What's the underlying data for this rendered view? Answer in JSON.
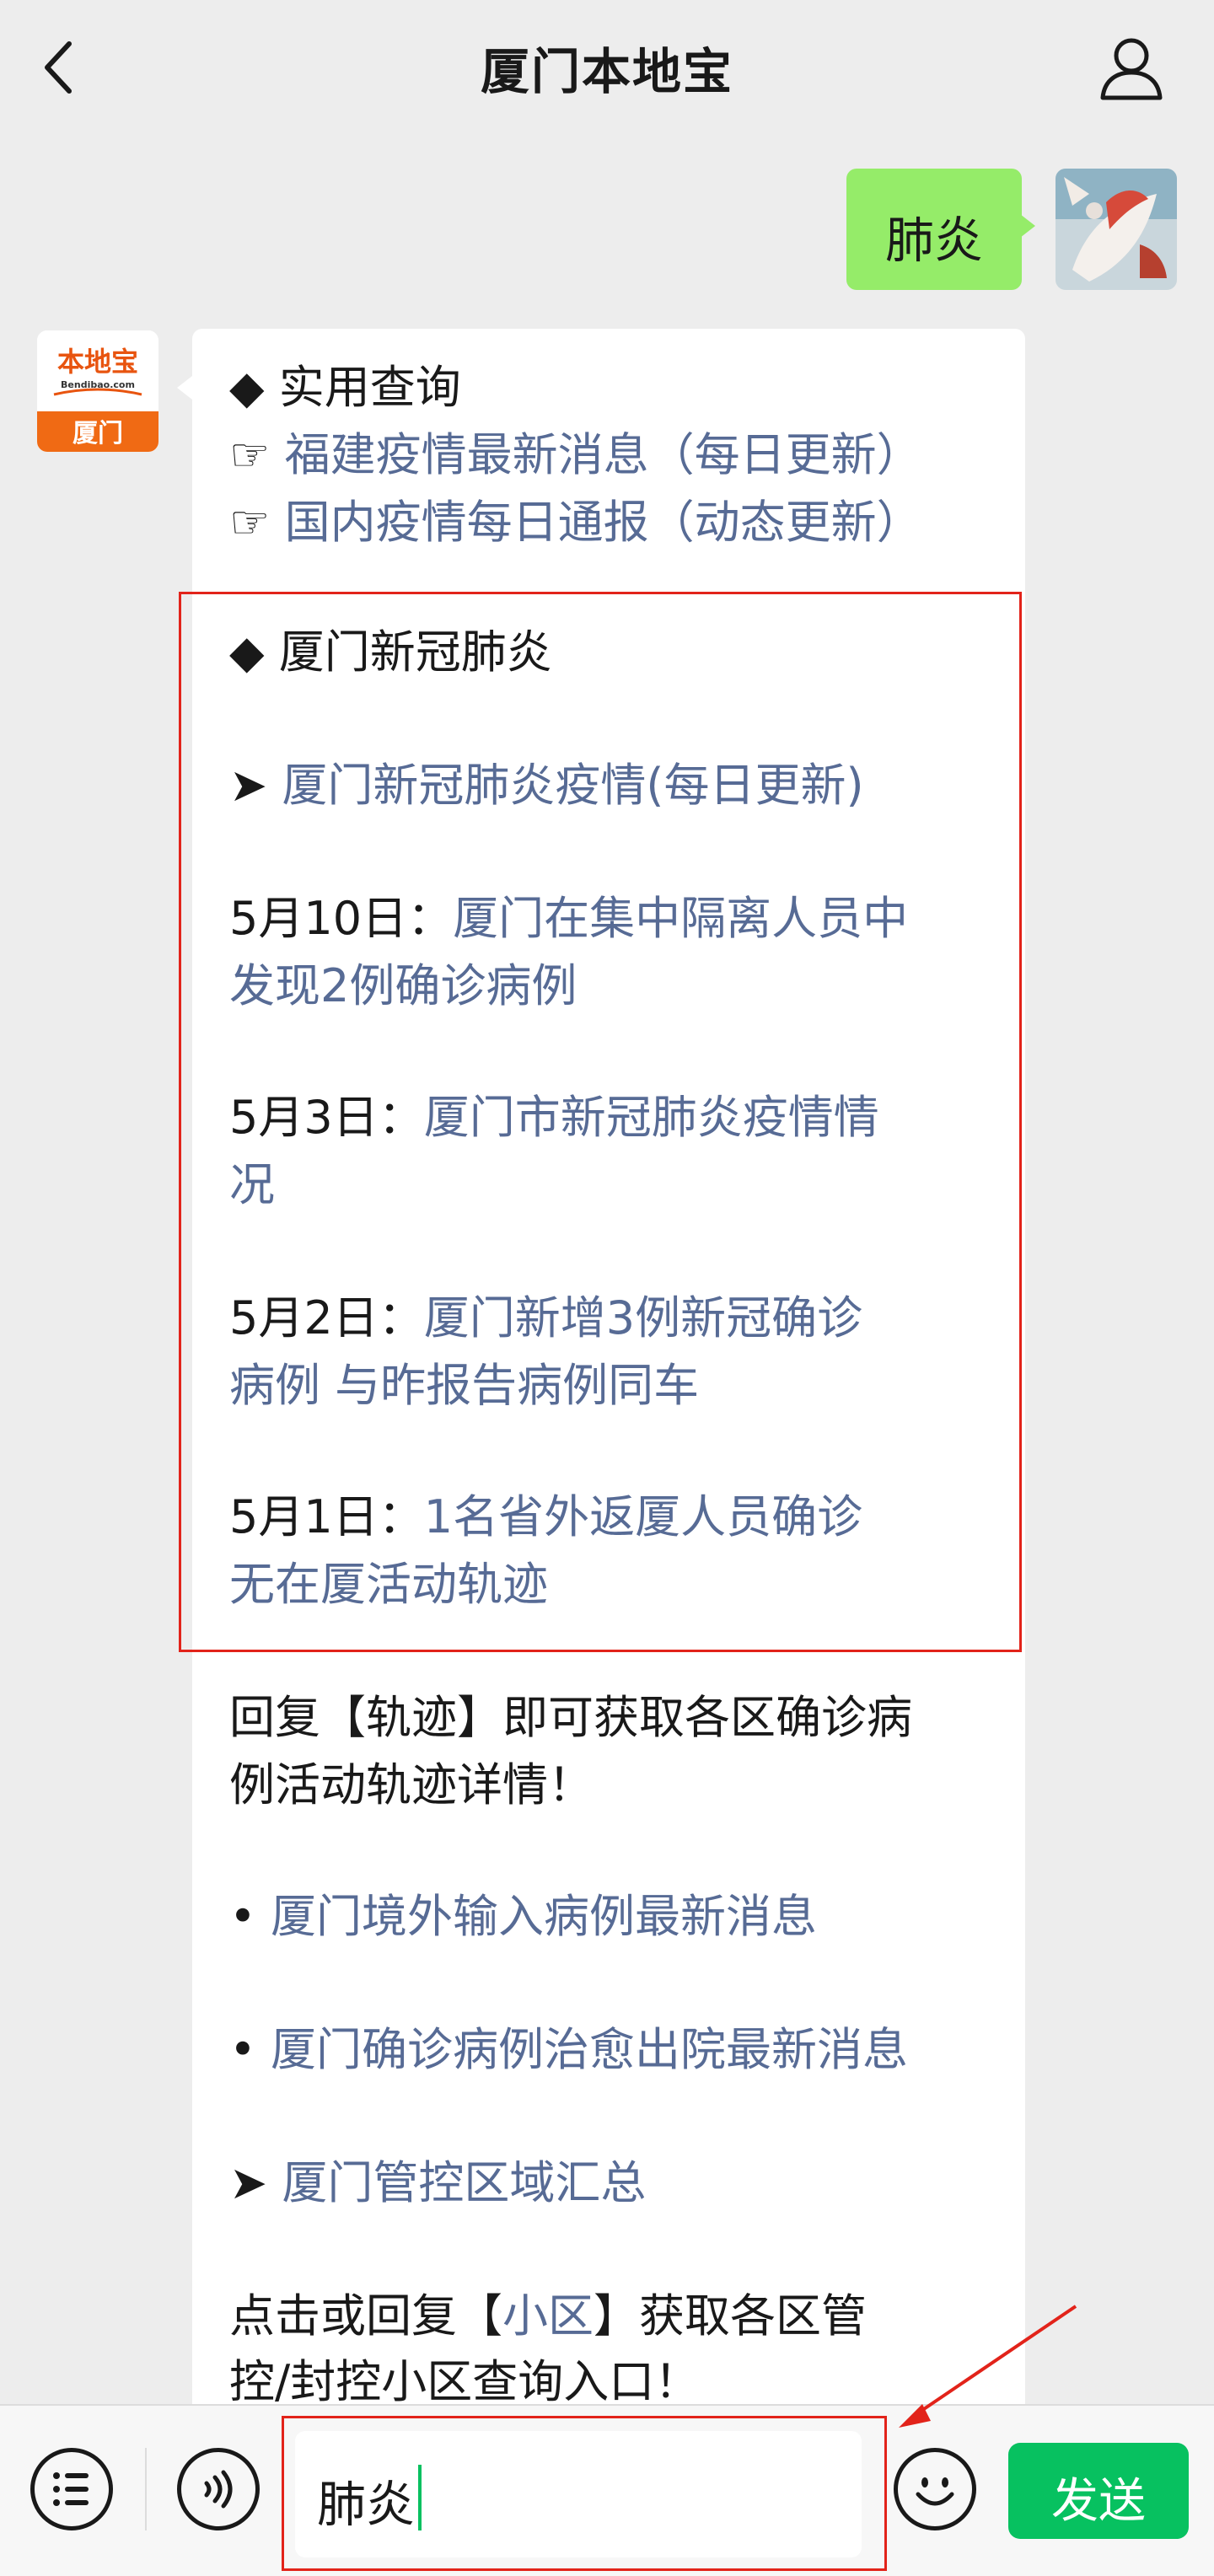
{
  "header": {
    "title": "厦门本地宝"
  },
  "outgoing": {
    "text": "肺炎"
  },
  "incoming": {
    "avatar": {
      "logo_cn": "本地宝",
      "logo_en": "Bendibao.com",
      "city": "厦门"
    },
    "lines": [
      {
        "prefix": "◆  ",
        "text": "实用查询",
        "link": false
      },
      {
        "prefix": "☞ ",
        "text": "福建疫情最新消息（每日更新）",
        "link": true
      },
      {
        "prefix": "☞ ",
        "text": "国内疫情每日通报（动态更新）",
        "link": true
      },
      {
        "prefix": "◆  ",
        "text": "厦门新冠肺炎",
        "link": false
      },
      {
        "prefix": "➤ ",
        "text": "厦门新冠肺炎疫情(每日更新)",
        "link": true
      },
      {
        "prefix": "5月10日：",
        "text": "厦门在集中隔离人员中",
        "link": true
      },
      {
        "prefix": "",
        "text": "发现2例确诊病例",
        "link": true
      },
      {
        "prefix": "5月3日：",
        "text": "厦门市新冠肺炎疫情情",
        "link": true
      },
      {
        "prefix": "",
        "text": "况",
        "link": true
      },
      {
        "prefix": "5月2日：",
        "text": "厦门新增3例新冠确诊",
        "link": true
      },
      {
        "prefix": "",
        "text": "病例 与昨报告病例同车",
        "link": true
      },
      {
        "prefix": "5月1日：",
        "text": "1名省外返厦人员确诊",
        "link": true
      },
      {
        "prefix": "",
        "text": "无在厦活动轨迹",
        "link": true
      },
      {
        "prefix": "",
        "text": "回复【轨迹】即可获取各区确诊病",
        "link": false
      },
      {
        "prefix": "",
        "text": "例活动轨迹详情！",
        "link": false
      },
      {
        "prefix": "•  ",
        "text": "厦门境外输入病例最新消息",
        "link": true
      },
      {
        "prefix": "•  ",
        "text": "厦门确诊病例治愈出院最新消息",
        "link": true
      },
      {
        "prefix": "➤ ",
        "text": "厦门管控区域汇总",
        "link": true
      },
      {
        "prefix": "",
        "text": "点击或回复【",
        "link": false,
        "mid": "小区",
        "suffix": "】获取各区管"
      },
      {
        "prefix": "",
        "text": "控/封控小区查询入口！",
        "link": false
      }
    ]
  },
  "composer": {
    "value": "肺炎",
    "send_label": "发送"
  },
  "colors": {
    "link": "#576b95",
    "accent": "#07c160",
    "bubble_out": "#95ec69",
    "highlight": "#e2231a"
  }
}
